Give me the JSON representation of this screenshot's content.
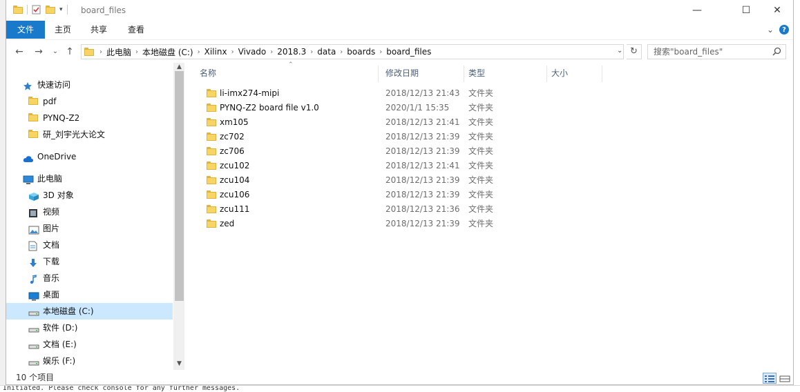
{
  "window": {
    "title": "board_files",
    "minimize": "—",
    "maximize": "☐",
    "close": "✕"
  },
  "ribbon": {
    "tabs": [
      "文件",
      "主页",
      "共享",
      "查看"
    ],
    "expand": "⌄",
    "help": "?"
  },
  "nav": {
    "back": "←",
    "forward": "→",
    "recent": "⌄",
    "up": "↑",
    "breadcrumbs": [
      "此电脑",
      "本地磁盘 (C:)",
      "Xilinx",
      "Vivado",
      "2018.3",
      "data",
      "boards",
      "board_files"
    ],
    "refresh": "↻",
    "search_placeholder": "搜索\"board_files\""
  },
  "sidebar": {
    "items": [
      {
        "label": "快速访问",
        "icon": "star-icon",
        "level": 0
      },
      {
        "label": "pdf",
        "icon": "folder-icon",
        "level": 1
      },
      {
        "label": "PYNQ-Z2",
        "icon": "folder-icon",
        "level": 1
      },
      {
        "label": "研_刘宇光大论文",
        "icon": "folder-icon",
        "level": 1
      },
      {
        "label": "OneDrive",
        "icon": "cloud-icon",
        "level": 0
      },
      {
        "label": "此电脑",
        "icon": "computer-icon",
        "level": 0
      },
      {
        "label": "3D 对象",
        "icon": "cube-icon",
        "level": 1
      },
      {
        "label": "视频",
        "icon": "video-icon",
        "level": 1
      },
      {
        "label": "图片",
        "icon": "picture-icon",
        "level": 1
      },
      {
        "label": "文档",
        "icon": "document-icon",
        "level": 1
      },
      {
        "label": "下载",
        "icon": "download-icon",
        "level": 1
      },
      {
        "label": "音乐",
        "icon": "music-icon",
        "level": 1
      },
      {
        "label": "桌面",
        "icon": "desktop-icon",
        "level": 1
      },
      {
        "label": "本地磁盘 (C:)",
        "icon": "drive-icon",
        "level": 1,
        "selected": true
      },
      {
        "label": "软件 (D:)",
        "icon": "drive-icon",
        "level": 1
      },
      {
        "label": "文档 (E:)",
        "icon": "drive-icon",
        "level": 1
      },
      {
        "label": "娱乐 (F:)",
        "icon": "drive-icon",
        "level": 1
      }
    ]
  },
  "columns": {
    "name": "名称",
    "date": "修改日期",
    "type": "类型",
    "size": "大小"
  },
  "files": [
    {
      "name": "li-imx274-mipi",
      "date": "2018/12/13 21:43",
      "type": "文件夹"
    },
    {
      "name": "PYNQ-Z2 board file v1.0",
      "date": "2020/1/1 15:35",
      "type": "文件夹"
    },
    {
      "name": "xm105",
      "date": "2018/12/13 21:41",
      "type": "文件夹"
    },
    {
      "name": "zc702",
      "date": "2018/12/13 21:39",
      "type": "文件夹"
    },
    {
      "name": "zc706",
      "date": "2018/12/13 21:39",
      "type": "文件夹"
    },
    {
      "name": "zcu102",
      "date": "2018/12/13 21:41",
      "type": "文件夹"
    },
    {
      "name": "zcu104",
      "date": "2018/12/13 21:39",
      "type": "文件夹"
    },
    {
      "name": "zcu106",
      "date": "2018/12/13 21:39",
      "type": "文件夹"
    },
    {
      "name": "zcu111",
      "date": "2018/12/13 21:36",
      "type": "文件夹"
    },
    {
      "name": "zed",
      "date": "2018/12/13 21:39",
      "type": "文件夹"
    }
  ],
  "status": {
    "count": "10 个项目"
  },
  "background": {
    "console_text": "Initiated. Please check console for any further messages."
  }
}
